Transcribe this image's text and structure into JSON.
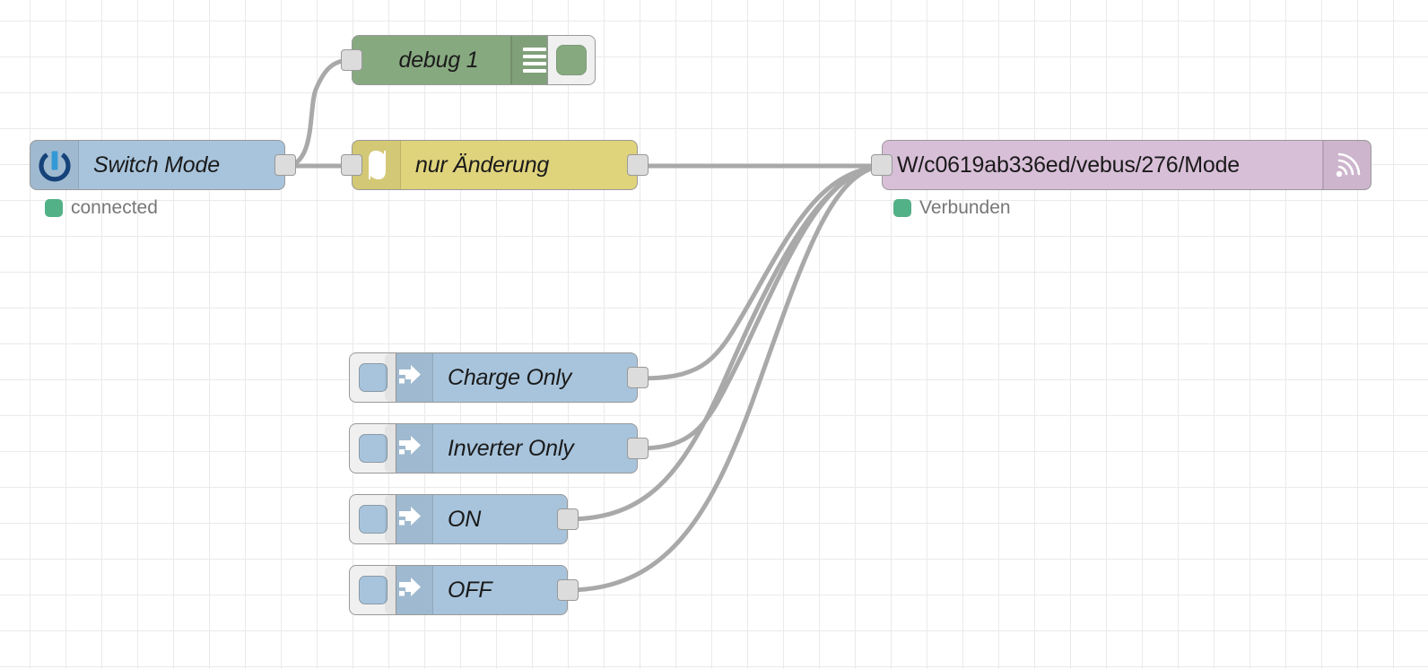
{
  "canvas": {
    "grid_size": 40,
    "background_color": "#ffffff",
    "grid_color": "#eaeaea",
    "wire_color": "#a9a9a9"
  },
  "nodes": {
    "switch_mode": {
      "label": "Switch Mode",
      "type": "victron-input-vebus",
      "color": "#a8c4dc",
      "icon": "victron-power-icon",
      "status": {
        "text": "connected",
        "color": "#53b187"
      }
    },
    "debug": {
      "label": "debug 1",
      "type": "debug",
      "color": "#87a980",
      "icon": "debug-list-icon",
      "button": "debug-toggle-button"
    },
    "rbe": {
      "label": "nur Änderung",
      "type": "rbe",
      "color": "#dfd37c",
      "icon": "step-filter-icon"
    },
    "mqtt": {
      "label": "W/c0619ab336ed/vebus/276/Mode",
      "type": "mqtt-out",
      "color": "#d8bfd8",
      "icon": "mqtt-broadcast-icon",
      "status": {
        "text": "Verbunden",
        "color": "#53b187"
      }
    },
    "injects": [
      {
        "label": "Charge Only",
        "color": "#a8c4dc",
        "icon": "inject-arrow-icon",
        "button": "inject-trigger-button"
      },
      {
        "label": "Inverter Only",
        "color": "#a8c4dc",
        "icon": "inject-arrow-icon",
        "button": "inject-trigger-button"
      },
      {
        "label": "ON",
        "color": "#a8c4dc",
        "icon": "inject-arrow-icon",
        "button": "inject-trigger-button"
      },
      {
        "label": "OFF",
        "color": "#a8c4dc",
        "icon": "inject-arrow-icon",
        "button": "inject-trigger-button"
      }
    ]
  }
}
